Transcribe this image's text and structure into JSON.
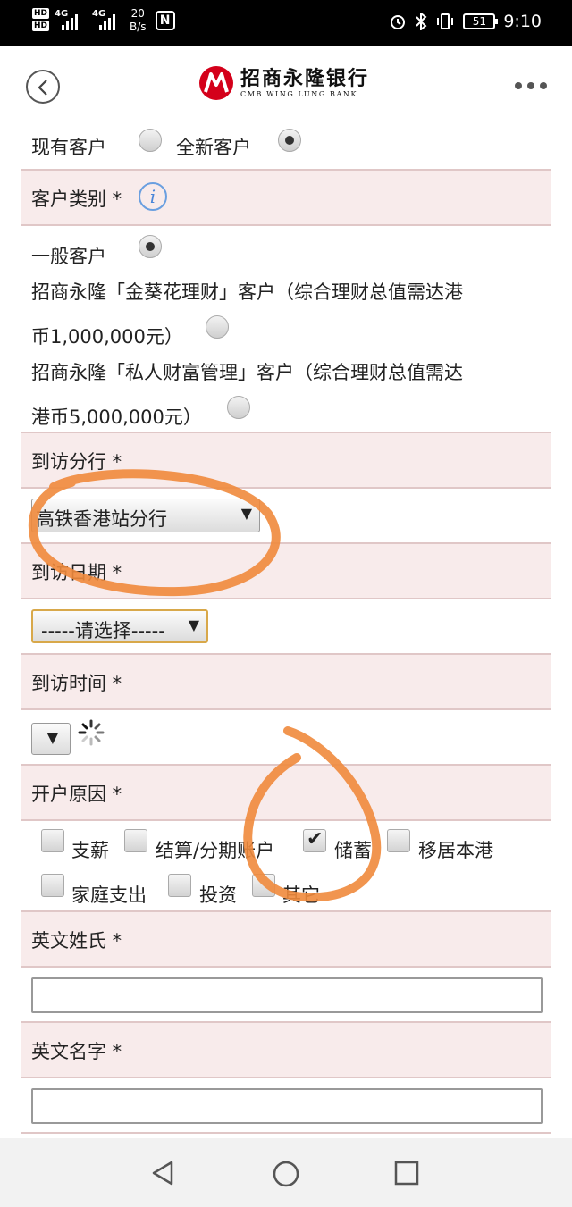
{
  "statusbar": {
    "hd1": "HD",
    "hd2": "HD",
    "net1": "4G",
    "net2": "4G",
    "speed_value": "20",
    "speed_unit": "B/s",
    "nfc": "N",
    "battery": "51",
    "time": "9:10"
  },
  "header": {
    "bank_name_cn": "招商永隆银行",
    "bank_name_en": "CMB WING LUNG BANK"
  },
  "form": {
    "customer_existing": "现有客户",
    "customer_new": "全新客户",
    "customer_type_label": "客户类别 *",
    "type_general": "一般客户",
    "type_sunflower_line1": "招商永隆「金葵花理财」客户（综合理财总值需达港",
    "type_sunflower_line2": "币1,000,000元）",
    "type_private_line1": "招商永隆「私人财富管理」客户（综合理财总值需达",
    "type_private_line2": "港币5,000,000元）",
    "branch_label": "到访分行 *",
    "branch_selected": "高铁香港站分行",
    "date_label": "到访日期 *",
    "date_selected": "-----请选择-----",
    "time_label": "到访时间 *",
    "reason_label": "开户原因 *",
    "reasons": [
      {
        "label": "支薪",
        "checked": false
      },
      {
        "label": "结算/分期账户",
        "checked": false
      },
      {
        "label": "储蓄",
        "checked": true
      },
      {
        "label": "移居本港",
        "checked": false
      },
      {
        "label": "家庭支出",
        "checked": false
      },
      {
        "label": "投资",
        "checked": false
      },
      {
        "label": "其它",
        "checked": false
      }
    ],
    "surname_label": "英文姓氏 *",
    "surname_value": "",
    "given_name_label": "英文名字 *",
    "given_name_value": ""
  },
  "colors": {
    "label_row_bg": "#f8ebeb",
    "annotation": "#f08a3c",
    "brand_red": "#d4001a"
  },
  "icons": {
    "back": "chevron-left-icon",
    "more": "more-dots-icon",
    "info": "info-icon",
    "spinner": "loading-spinner-icon"
  }
}
